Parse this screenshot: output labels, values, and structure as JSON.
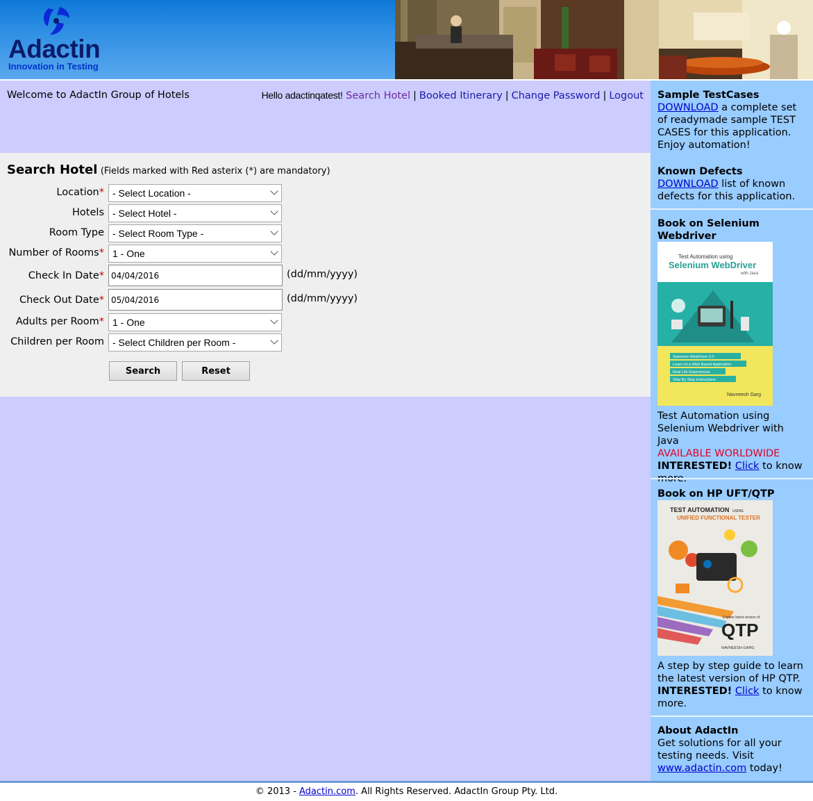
{
  "header": {
    "logo_text": "Adactin",
    "logo_tagline": "Innovation in Testing"
  },
  "topbar": {
    "welcome": "Welcome to AdactIn Group of Hotels",
    "hello": "Hello adactinqatest!",
    "nav": [
      "Search Hotel",
      "Booked Itinerary",
      "Change Password",
      "Logout"
    ],
    "sep": "|"
  },
  "form": {
    "title": "Search Hotel",
    "note": "(Fields marked with Red asterix (*) are mandatory)",
    "required_mark": "*",
    "fields": {
      "location": {
        "label": "Location",
        "value": "- Select Location -"
      },
      "hotels": {
        "label": "Hotels",
        "value": "- Select Hotel -"
      },
      "room_type": {
        "label": "Room Type",
        "value": "- Select Room Type -"
      },
      "rooms": {
        "label": "Number of Rooms",
        "value": "1 - One"
      },
      "checkin": {
        "label": "Check In Date",
        "value": "04/04/2016"
      },
      "checkout": {
        "label": "Check Out Date",
        "value": "05/04/2016"
      },
      "adults": {
        "label": "Adults per Room",
        "value": "1 - One"
      },
      "children": {
        "label": "Children per Room",
        "value": "- Select Children per Room -"
      }
    },
    "date_format": "(dd/mm/yyyy)",
    "search_button": "Search",
    "reset_button": "Reset"
  },
  "sidebar": {
    "sample": {
      "heading": "Sample TestCases",
      "link": "DOWNLOAD",
      "text": " a complete set of readymade sample TEST CASES for this application. Enjoy automation!"
    },
    "defects": {
      "heading": "Known Defects",
      "link": "DOWNLOAD",
      "text": " list of known defects for this application."
    },
    "selenium": {
      "heading": "Book on Selenium Webdriver",
      "cover_title_small": "Test Automation using",
      "cover_title_big": "Selenium WebDriver",
      "cover_sub": "with Java",
      "cover_bullets": [
        "Selenium WebDriver 2.0",
        "Learn on a Web Based Application",
        "Real Life Experiences",
        "Step By Step Instructions"
      ],
      "cover_author": "Navneesh Garg",
      "desc": "Test Automation using Selenium Webdriver with Java",
      "avail": "AVAILABLE WORLDWIDE",
      "interested": "INTERESTED!",
      "link": "Click",
      "tail": " to know more."
    },
    "qtp": {
      "heading": "Book on HP UFT/QTP",
      "cover_title_small": "TEST AUTOMATION",
      "cover_using": "USING",
      "cover_title_big": "UNIFIED FUNCTIONAL TESTER",
      "cover_qtp": "QTP",
      "cover_explore": "Explore latest version of",
      "cover_author": "NAVNEESH GARG",
      "desc": "A step by step guide to learn the latest version of HP QTP.",
      "interested": "INTERESTED!",
      "link": "Click",
      "tail": " to know more."
    },
    "about": {
      "heading": "About AdactIn",
      "text": "Get solutions for all your testing needs. Visit ",
      "link": "www.adactin.com",
      "tail": " today!"
    }
  },
  "footer": {
    "prefix": "© 2013 - ",
    "link": "Adactin.com",
    "suffix": ". All Rights Reserved. AdactIn Group Pty. Ltd."
  },
  "colors": {
    "main_bg": "#ccccff",
    "form_bg": "#efefef",
    "sidebar_bg": "#99ccff",
    "link": "#1a1aa6",
    "required": "#d00000",
    "avail": "#e0002a"
  }
}
